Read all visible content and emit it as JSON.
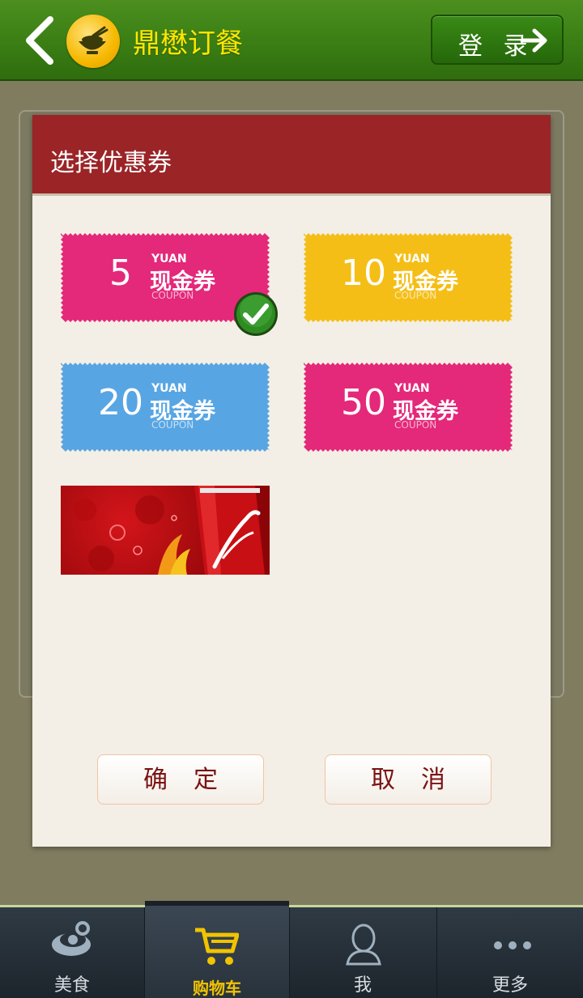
{
  "header": {
    "app_title": "鼎懋订餐",
    "login_label": "登 录"
  },
  "dialog": {
    "title": "选择优惠券",
    "coupons": [
      {
        "value": "5",
        "yuan": "YUAN",
        "name": "现金券",
        "sub": "COUPON",
        "color": "#e4287a",
        "selected": true
      },
      {
        "value": "10",
        "yuan": "YUAN",
        "name": "现金券",
        "sub": "COUPON",
        "color": "#f5be17",
        "selected": false
      },
      {
        "value": "20",
        "yuan": "YUAN",
        "name": "现金券",
        "sub": "COUPON",
        "color": "#58a5e3",
        "selected": false
      },
      {
        "value": "50",
        "yuan": "YUAN",
        "name": "现金券",
        "sub": "COUPON",
        "color": "#e4287a",
        "selected": false
      }
    ],
    "confirm_label": "确定",
    "cancel_label": "取消"
  },
  "nav": {
    "items": [
      {
        "label": "美食",
        "icon": "bowl-icon",
        "active": false
      },
      {
        "label": "购物车",
        "icon": "cart-icon",
        "active": true
      },
      {
        "label": "我",
        "icon": "person-icon",
        "active": false
      },
      {
        "label": "更多",
        "icon": "more-icon",
        "active": false
      }
    ]
  },
  "colors": {
    "header_green": "#3a7e14",
    "title_yellow": "#ffe600",
    "dialog_red": "#9b2427",
    "nav_active": "#f1c400"
  }
}
